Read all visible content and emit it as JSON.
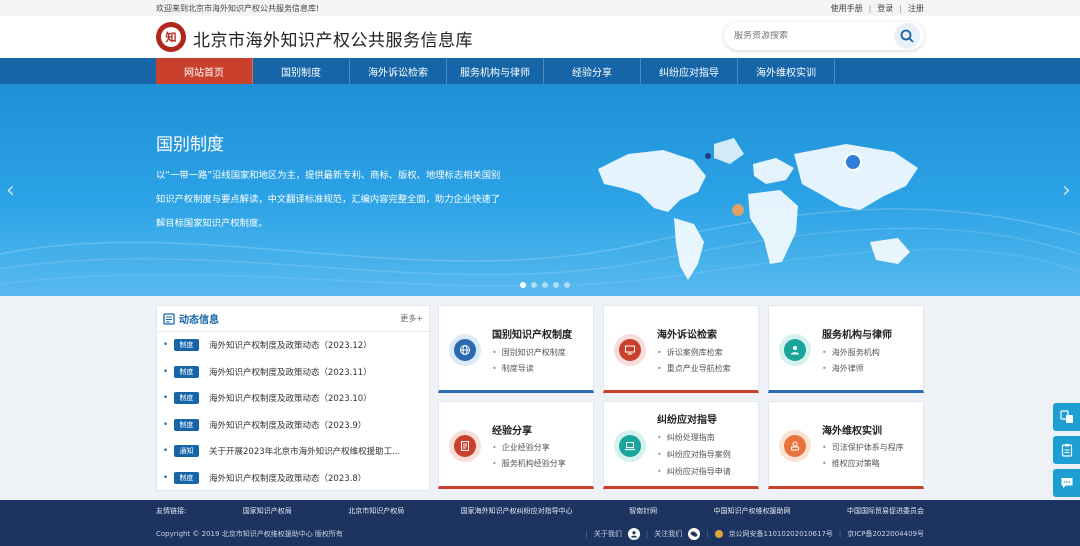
{
  "topbar": {
    "welcome": "欢迎来到北京市海外知识产权公共服务信息库!",
    "manual": "使用手册",
    "login": "登录",
    "register": "注册",
    "sep": "|"
  },
  "header": {
    "title": "北京市海外知识产权公共服务信息库",
    "search_placeholder": "服务资源搜索",
    "logo_letter": "知"
  },
  "nav": {
    "items": [
      "网站首页",
      "国别制度",
      "海外诉讼检索",
      "服务机构与律师",
      "经验分享",
      "纠纷应对指导",
      "海外维权实训"
    ]
  },
  "banner": {
    "title": "国别制度",
    "description": "以“一带一路”沿线国家和地区为主，提供最新专利、商标、版权、地理标志相关国别知识产权制度与要点解读，中文翻译标准规范，汇编内容完整全面，助力企业快速了解目标国家知识产权制度。",
    "prev_arrow": "‹",
    "next_arrow": "›"
  },
  "news": {
    "title": "动态信息",
    "more": "更多+",
    "items": [
      {
        "badge": "制度",
        "text": "海外知识产权制度及政策动态（2023.12）"
      },
      {
        "badge": "制度",
        "text": "海外知识产权制度及政策动态（2023.11）"
      },
      {
        "badge": "制度",
        "text": "海外知识产权制度及政策动态（2023.10）"
      },
      {
        "badge": "制度",
        "text": "海外知识产权制度及政策动态（2023.9）"
      },
      {
        "badge": "通知",
        "text": "关于开展2023年北京市海外知识产权维权援助工..."
      },
      {
        "badge": "制度",
        "text": "海外知识产权制度及政策动态（2023.8）"
      }
    ]
  },
  "cards": [
    {
      "title": "国别知识产权制度",
      "subs": [
        "国别知识产权制度",
        "制度导读"
      ],
      "icon": "globe-icon",
      "color": "#2a6bb0"
    },
    {
      "title": "海外诉讼检索",
      "subs": [
        "诉讼案例库检索",
        "重点产业导航检索"
      ],
      "icon": "monitor-icon",
      "color": "#c9412c"
    },
    {
      "title": "服务机构与律师",
      "subs": [
        "海外服务机构",
        "海外律师"
      ],
      "icon": "lawyer-icon",
      "color": "#1aa59a"
    },
    {
      "title": "经验分享",
      "subs": [
        "企业经验分享",
        "服务机构经验分享"
      ],
      "icon": "document-icon",
      "color": "#c9412c"
    },
    {
      "title": "纠纷应对指导",
      "subs": [
        "纠纷处理指南",
        "纠纷应对指导案例",
        "纠纷应对指导申请"
      ],
      "icon": "laptop-icon",
      "color": "#1aa59a"
    },
    {
      "title": "海外维权实训",
      "subs": [
        "司法保护体系与程序",
        "维权应对策略"
      ],
      "icon": "training-icon",
      "color": "#e8733c"
    }
  ],
  "footer": {
    "links_label": "友情链接:",
    "links": [
      "国家知识产权局",
      "北京市知识产权局",
      "国家海外知识产权纠纷应对指导中心",
      "智南针网",
      "中国知识产权维权援助网",
      "中国国际贸易促进委员会"
    ],
    "copyright": "Copyright © 2019 北京市知识产权维权援助中心 版权所有",
    "about": "关于我们",
    "follow": "关注我们",
    "police_record": "京公网安备11010202010617号",
    "icp": "京ICP备2022004409号",
    "sep": "|"
  }
}
